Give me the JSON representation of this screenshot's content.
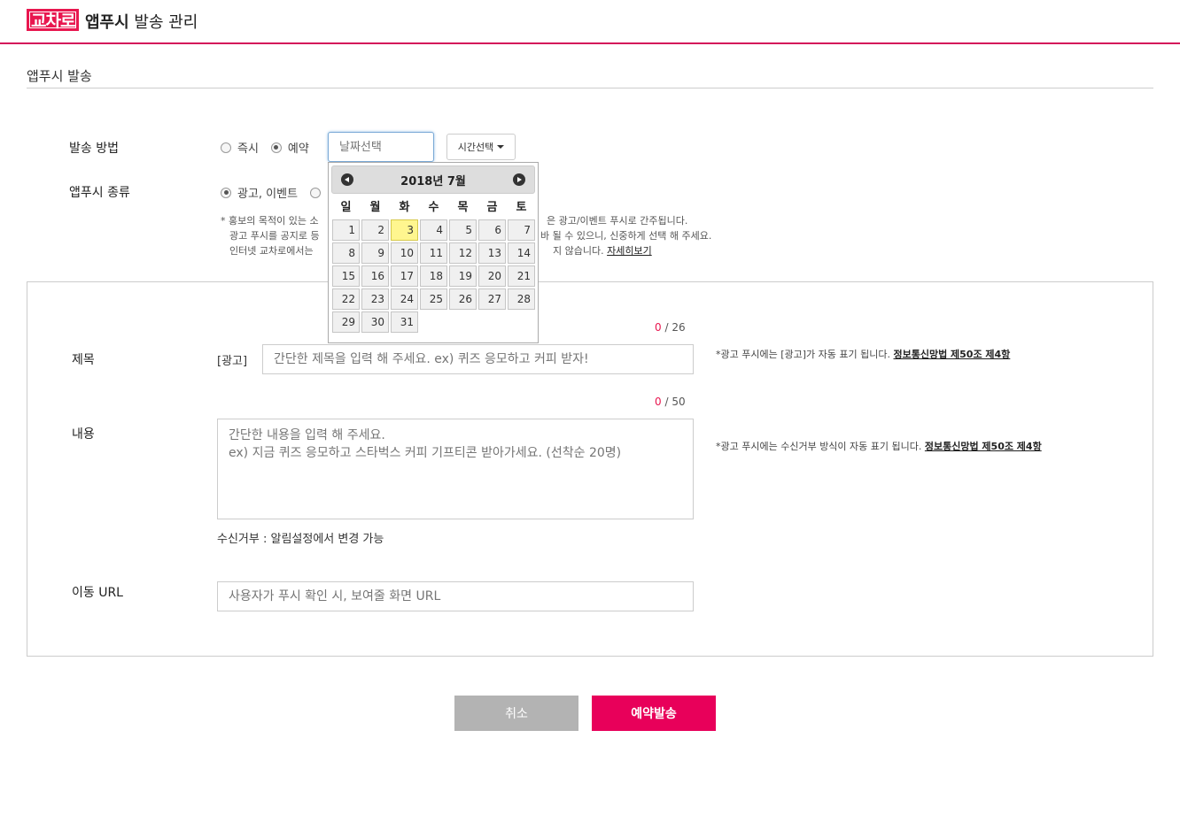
{
  "header": {
    "logo": "교차로",
    "title_bold": "앱푸시",
    "title_rest": " 발송 관리"
  },
  "section": {
    "title": "앱푸시 발송"
  },
  "send_method": {
    "label": "발송 방법",
    "options": [
      "즉시",
      "예약"
    ],
    "selected": "예약",
    "date_placeholder": "날짜선택",
    "time_button": "시간선택"
  },
  "push_type": {
    "label": "앱푸시 종류",
    "option": "광고, 이벤트"
  },
  "notice": {
    "line1_left": "* 홍보의 목적이 있는 소",
    "line1_right": "은 광고/이벤트 푸시로 간주됩니다.",
    "line2_left": "광고 푸시를 공지로 등",
    "line2_right": "바 될 수 있으니, 신중하게 선택 해 주세요.",
    "line3_left": "인터넷 교차로에서는",
    "line3_right": "지 않습니다.",
    "link": "자세히보기"
  },
  "calendar": {
    "title": "2018년 7월",
    "weekdays": [
      "일",
      "월",
      "화",
      "수",
      "목",
      "금",
      "토"
    ],
    "today": 3
  },
  "title_field": {
    "label": "제목",
    "prefix": "[광고]",
    "placeholder": "간단한 제목을 입력 해 주세요. ex) 퀴즈 응모하고 커피 받자!",
    "count": "0",
    "max": " / 26",
    "note": "*광고 푸시에는 [광고]가 자동 표기 됩니다. ",
    "note_link": "정보통신망법 제50조 제4항"
  },
  "content_field": {
    "label": "내용",
    "placeholder": "간단한 내용을 입력 해 주세요.\nex) 지금 퀴즈 응모하고 스타벅스 커피 기프티콘 받아가세요. (선착순 20명)",
    "count": "0",
    "max": " / 50",
    "note": "*광고 푸시에는 수신거부 방식이 자동 표기 됩니다. ",
    "note_link": "정보통신망법 제50조 제4항",
    "optout": "수신거부 : 알림설정에서 변경 가능"
  },
  "url_field": {
    "label": "이동 URL",
    "placeholder": "사용자가 푸시 확인 시, 보여줄 화면 URL"
  },
  "buttons": {
    "cancel": "취소",
    "submit": "예약발송"
  },
  "colors": {
    "accent": "#e8005a",
    "today": "#fff68f"
  }
}
